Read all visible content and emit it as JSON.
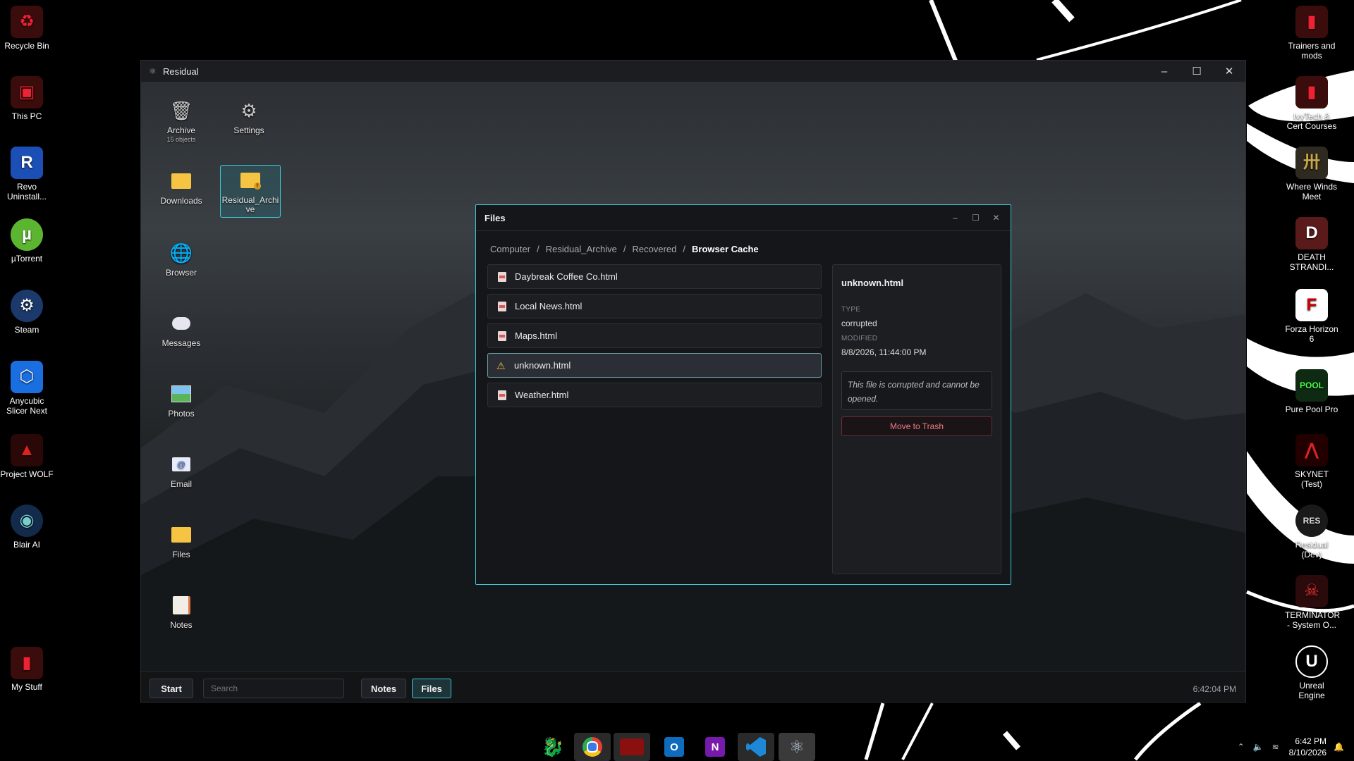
{
  "desktop_left_icons": [
    {
      "label": "Recycle Bin",
      "icon": "recycle-bin-icon"
    },
    {
      "label": "This PC",
      "icon": "computer-icon"
    },
    {
      "label": "Revo Uninstall...",
      "icon": "revo-uninstaller-icon"
    },
    {
      "label": "µTorrent",
      "icon": "utorrent-icon"
    },
    {
      "label": "Steam",
      "icon": "steam-icon"
    },
    {
      "label": "Anycubic Slicer Next",
      "icon": "anycubic-icon"
    },
    {
      "label": "Project WOLF",
      "icon": "wolf-icon"
    },
    {
      "label": "Blair AI",
      "icon": "blair-icon"
    },
    {
      "label": "My Stuff",
      "icon": "folder-icon"
    }
  ],
  "desktop_right_icons": [
    {
      "label": "Trainers and mods",
      "icon": "folder-icon"
    },
    {
      "label": "IvyTech & Cert Courses",
      "icon": "folder-icon"
    },
    {
      "label": "Where Winds Meet",
      "icon": "game-icon"
    },
    {
      "label": "DEATH STRANDI...",
      "icon": "game-icon"
    },
    {
      "label": "Forza Horizon 6",
      "icon": "forza-icon"
    },
    {
      "label": "Pure Pool Pro",
      "icon": "pool-icon"
    },
    {
      "label": "SKYNET (Test)",
      "icon": "skynet-icon"
    },
    {
      "label": "Residual (Dev)",
      "icon": "residual-icon"
    },
    {
      "label": "TERMINATOR - System O...",
      "icon": "terminator-icon"
    },
    {
      "label": "Unreal Engine",
      "icon": "unreal-icon"
    }
  ],
  "residual_window": {
    "title": "Residual",
    "controls": {
      "minimize": "–",
      "maximize": "☐",
      "close": "✕"
    },
    "icons": [
      {
        "label": "Archive",
        "sub": "15 objects",
        "icon": "trash-bin-icon"
      },
      {
        "label": "Settings",
        "icon": "gear-icon"
      },
      {
        "label": "Downloads",
        "icon": "folder-icon"
      },
      {
        "label": "Residual_Archive",
        "icon": "folder-alert-icon"
      },
      {
        "label": "Browser",
        "icon": "globe-icon"
      },
      {
        "label": "Messages",
        "icon": "chat-bubble-icon"
      },
      {
        "label": "Photos",
        "icon": "image-icon"
      },
      {
        "label": "Email",
        "icon": "email-icon"
      },
      {
        "label": "Files",
        "icon": "folder-icon"
      },
      {
        "label": "Notes",
        "icon": "notes-icon"
      }
    ],
    "taskbar": {
      "start_label": "Start",
      "search_placeholder": "Search",
      "apps": [
        "Notes",
        "Files"
      ],
      "active_app": "Files",
      "clock": "6:42:04 PM"
    }
  },
  "files_window": {
    "title": "Files",
    "controls": {
      "minimize": "–",
      "maximize": "☐",
      "close": "✕"
    },
    "breadcrumb": [
      "Computer",
      "Residual_Archive",
      "Recovered",
      "Browser Cache"
    ],
    "separator": "/",
    "files": [
      {
        "name": "Daybreak Coffee Co.html",
        "icon": "html-file-icon"
      },
      {
        "name": "Local News.html",
        "icon": "html-file-icon"
      },
      {
        "name": "Maps.html",
        "icon": "html-file-icon"
      },
      {
        "name": "unknown.html",
        "icon": "warning-icon",
        "selected": true
      },
      {
        "name": "Weather.html",
        "icon": "html-file-icon"
      }
    ],
    "details": {
      "name": "unknown.html",
      "type_label": "TYPE",
      "type_value": "corrupted",
      "modified_label": "MODIFIED",
      "modified_value": "8/8/2026, 11:44:00 PM",
      "note": "This file is corrupted and cannot be opened.",
      "action": "Move to Trash"
    }
  },
  "windows_taskbar": {
    "apps": [
      "msi-dragon-icon",
      "chrome-icon",
      "msi-center-icon",
      "outlook-icon",
      "onenote-icon",
      "vscode-icon",
      "electron-icon"
    ],
    "tray": {
      "time": "6:42 PM",
      "date": "8/10/2026"
    }
  },
  "colors": {
    "accent": "#3ec7d6",
    "danger": "#f07c84",
    "warning": "#f2b632"
  }
}
